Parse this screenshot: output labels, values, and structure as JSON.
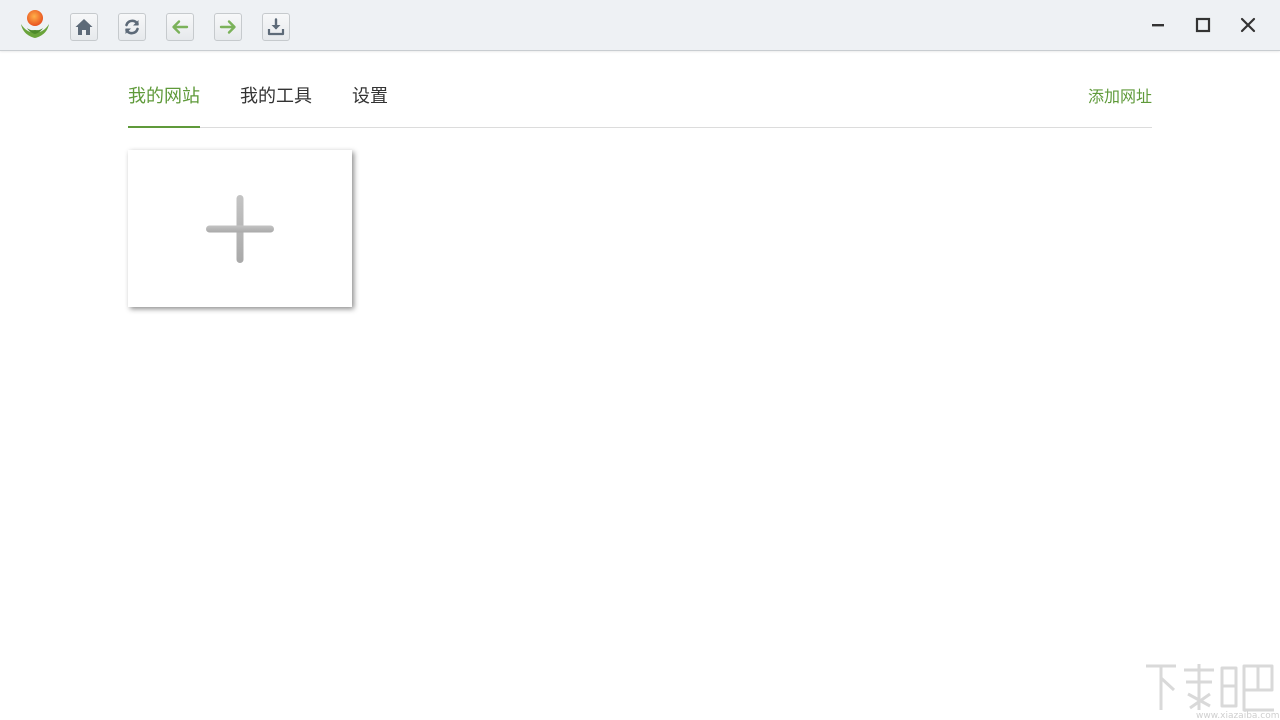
{
  "colors": {
    "accent": "#5f9a3a",
    "titlebar_bg": "#eef1f4",
    "tab_text": "#333333"
  },
  "toolbar": {
    "buttons": [
      {
        "icon": "home-icon"
      },
      {
        "icon": "refresh-icon"
      },
      {
        "icon": "back-arrow-icon"
      },
      {
        "icon": "forward-arrow-icon"
      },
      {
        "icon": "download-icon"
      }
    ]
  },
  "window_controls": [
    "minimize-icon",
    "maximize-icon",
    "close-icon"
  ],
  "tabs": {
    "items": [
      {
        "label": "我的网站",
        "active": true
      },
      {
        "label": "我的工具",
        "active": false
      },
      {
        "label": "设置",
        "active": false
      }
    ],
    "add_url_label": "添加网址"
  },
  "grid": {
    "add_tile_icon": "plus-icon"
  },
  "watermark": {
    "logo": "xiazaiba-logo-icon",
    "text": "www.xiazaiba.com"
  }
}
